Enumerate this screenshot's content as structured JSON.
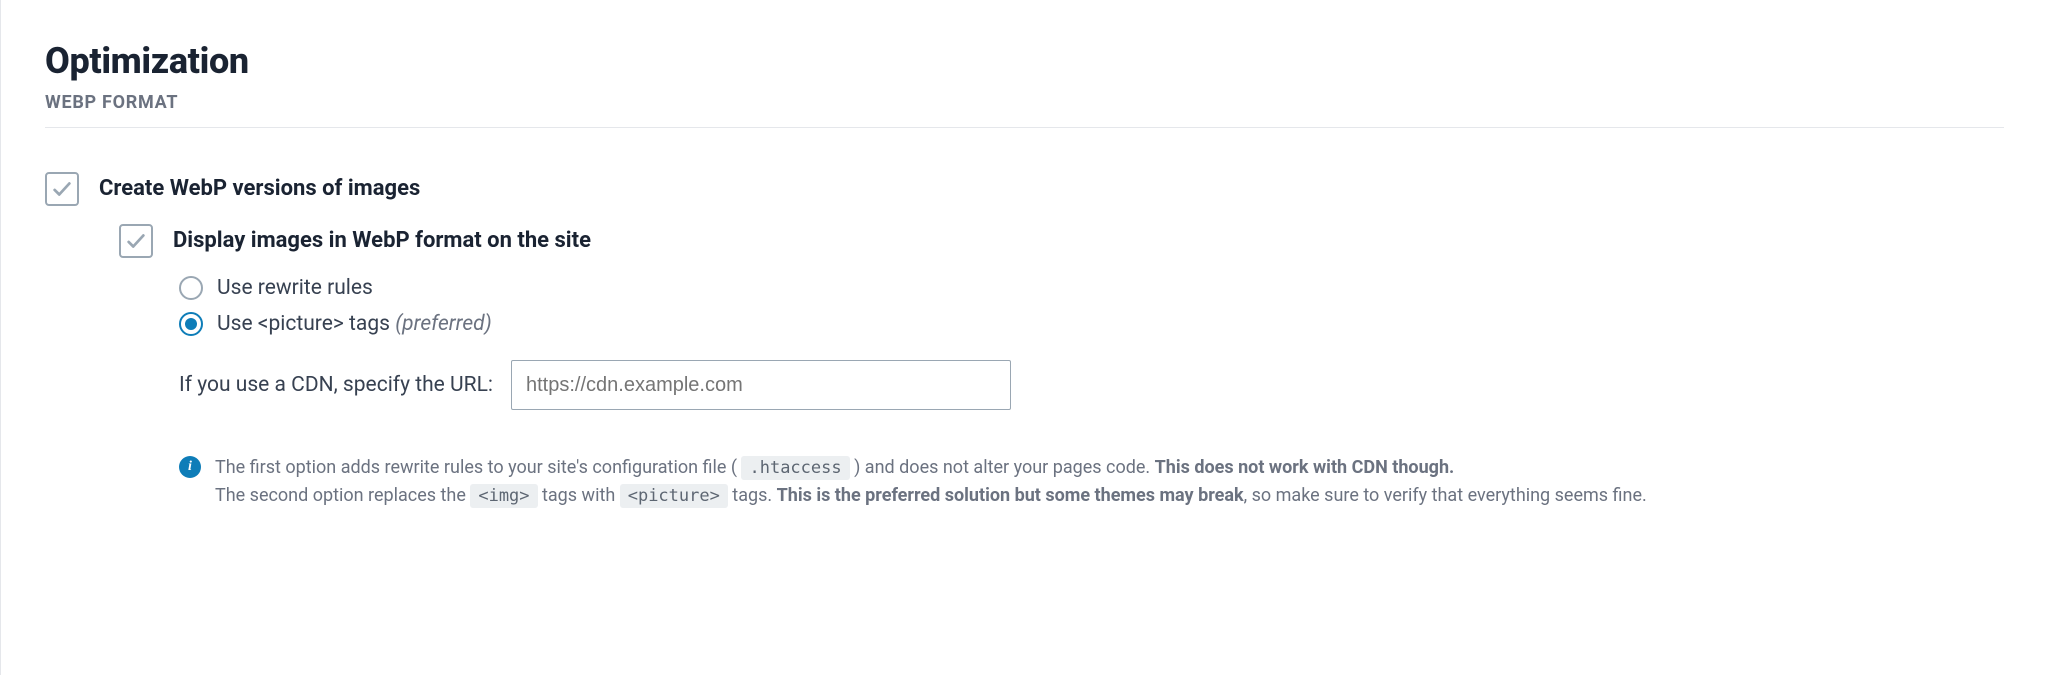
{
  "title": "Optimization",
  "section_label": "WEBP FORMAT",
  "create_webp": {
    "label": "Create WebP versions of images",
    "checked": true
  },
  "display_webp": {
    "label": "Display images in WebP format on the site",
    "checked": true,
    "options": {
      "rewrite": {
        "label": "Use rewrite rules",
        "selected": false
      },
      "picture": {
        "label_prefix": "Use <picture> tags ",
        "preferred": "(preferred)",
        "selected": true
      }
    },
    "cdn": {
      "label": "If you use a CDN, specify the URL:",
      "placeholder": "https://cdn.example.com",
      "value": ""
    }
  },
  "info": {
    "line1_a": "The first option adds rewrite rules to your site's configuration file ( ",
    "code_htaccess": ".htaccess",
    "line1_b": " ) and does not alter your pages code. ",
    "line1_strong": "This does not work with CDN though.",
    "line2_a": "The second option replaces the ",
    "code_img": "<img>",
    "line2_b": " tags with ",
    "code_picture": "<picture>",
    "line2_c": " tags. ",
    "line2_strong": "This is the preferred solution but some themes may break",
    "line2_d": ", so make sure to verify that everything seems fine."
  }
}
